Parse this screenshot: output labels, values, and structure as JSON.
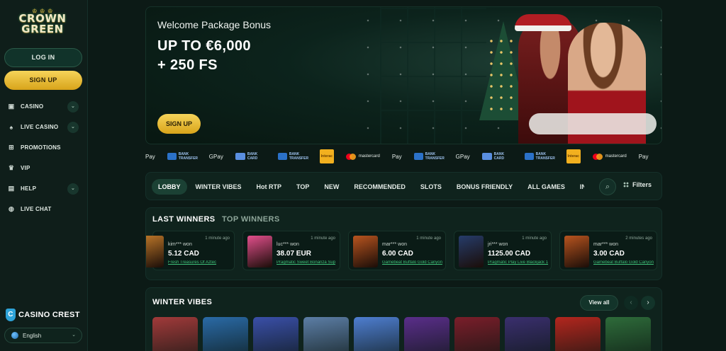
{
  "brand": {
    "logo_text": "CROWN GREEN",
    "logo_line1": "CROWN",
    "logo_line2": "GREEN"
  },
  "auth": {
    "login_label": "LOG IN",
    "signup_label": "SIGN UP"
  },
  "sidebar": {
    "items": [
      {
        "label": "CASINO",
        "icon": "casino-icon",
        "expandable": true
      },
      {
        "label": "LIVE CASINO",
        "icon": "live-casino-icon",
        "expandable": true
      },
      {
        "label": "PROMOTIONS",
        "icon": "gift-icon",
        "expandable": false
      },
      {
        "label": "VIP",
        "icon": "crown-icon",
        "expandable": false
      },
      {
        "label": "HELP",
        "icon": "help-icon",
        "expandable": true
      },
      {
        "label": "LIVE CHAT",
        "icon": "chat-icon",
        "expandable": false
      }
    ],
    "crest_label": "CASINO CREST",
    "language": "English"
  },
  "hero": {
    "subtitle": "Welcome Package Bonus",
    "title_line1": "UP TO €6,000",
    "title_line2": "+ 250 FS",
    "cta_label": "SIGN UP"
  },
  "payments": [
    {
      "type": "apple",
      "label": "Pay"
    },
    {
      "type": "bank",
      "label": "BANK TRANSFER"
    },
    {
      "type": "gpay",
      "label": "Pay"
    },
    {
      "type": "card",
      "label": "BANK CARD"
    },
    {
      "type": "bank",
      "label": "BANK TRANSFER"
    },
    {
      "type": "interac",
      "label": "Interac"
    },
    {
      "type": "mc",
      "label": "mastercard"
    },
    {
      "type": "apple",
      "label": "Pay"
    },
    {
      "type": "bank",
      "label": "BANK TRANSFER"
    },
    {
      "type": "gpay",
      "label": "Pay"
    },
    {
      "type": "card",
      "label": "BANK CARD"
    },
    {
      "type": "bank",
      "label": "BANK TRANSFER"
    },
    {
      "type": "interac",
      "label": "Interac"
    },
    {
      "type": "mc",
      "label": "mastercard"
    },
    {
      "type": "apple",
      "label": "Pay"
    }
  ],
  "tabs": {
    "items": [
      "LOBBY",
      "WINTER VIBES",
      "Hot RTP",
      "TOP",
      "NEW",
      "RECOMMENDED",
      "SLOTS",
      "BONUS FRIENDLY",
      "ALL GAMES",
      "INSTANT"
    ],
    "active_index": 0,
    "filters_label": "Filters"
  },
  "winners": {
    "tab_active": "LAST WINNERS",
    "tab_inactive": "TOP WINNERS",
    "cards": [
      {
        "user": "kim*** won",
        "time": "1 minute ago",
        "amount": "5.12 CAD",
        "game": "Fresh Treasures Of Aztec",
        "color": "#c27a2a",
        "partial": true
      },
      {
        "user": "luc*** won",
        "time": "1 minute ago",
        "amount": "38.07 EUR",
        "game": "Pragmatic Sweet Bonanza Sup",
        "color": "#e24f8c",
        "partial": false
      },
      {
        "user": "mar*** won",
        "time": "1 minute ago",
        "amount": "6.00 CAD",
        "game": "Gamebeat Buffalo Gold Canyon",
        "color": "#b8541f",
        "partial": false
      },
      {
        "user": "jri*** won",
        "time": "1 minute ago",
        "amount": "1125.00 CAD",
        "game": "Pragmatic Play Live Blackjack 1",
        "color": "#263c6a",
        "partial": false
      },
      {
        "user": "mar*** won",
        "time": "2 minutes ago",
        "amount": "3.00 CAD",
        "game": "Gamebeat Buffalo Gold Canyon",
        "color": "#b8541f",
        "partial": false
      }
    ]
  },
  "vibes": {
    "title": "WINTER VIBES",
    "view_all_label": "View all",
    "games": [
      {
        "name": "santa-game",
        "color": "#a13a3a"
      },
      {
        "name": "ice-game",
        "color": "#2a6aa6"
      },
      {
        "name": "mini-gems-game",
        "color": "#3a4fa8"
      },
      {
        "name": "polar-bear-game",
        "color": "#5c7ea6"
      },
      {
        "name": "santa-snow-game",
        "color": "#4e7ed0"
      },
      {
        "name": "ninja-game",
        "color": "#5a2e8a"
      },
      {
        "name": "santa-hat-game",
        "color": "#7a1e2a"
      },
      {
        "name": "wolf-game",
        "color": "#3a2f6e"
      },
      {
        "name": "elf-game",
        "color": "#b3261e"
      },
      {
        "name": "dwarf-game",
        "color": "#2e6b3a"
      }
    ]
  },
  "colors": {
    "accent_gold": "#e6b933",
    "bg": "#0c1a16",
    "panel": "#0f231d",
    "link_green": "#3fc27a"
  }
}
